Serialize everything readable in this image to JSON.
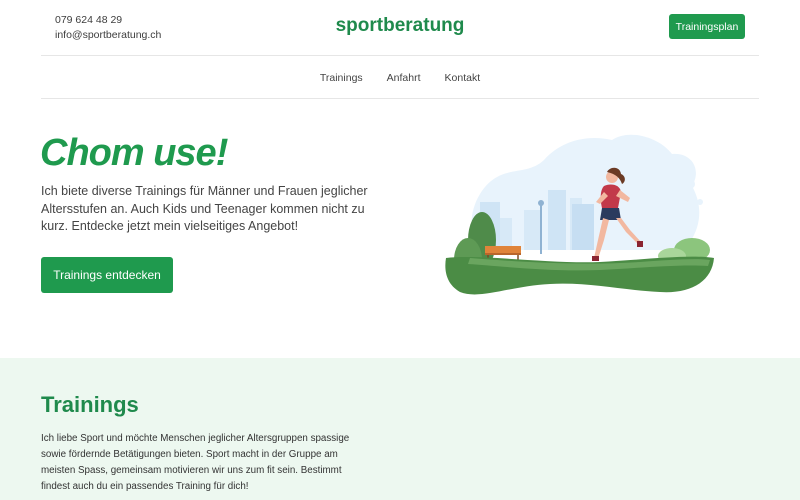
{
  "header": {
    "phone": "079 624 48 29",
    "email": "info@sportberatung.ch",
    "brand": "sportberatung",
    "cta_label": "Trainingsplan"
  },
  "nav": {
    "items": [
      {
        "label": "Trainings"
      },
      {
        "label": "Anfahrt"
      },
      {
        "label": "Kontakt"
      }
    ]
  },
  "hero": {
    "title": "Chom use!",
    "text": "Ich biete diverse Trainings für Männer und Frauen jeglicher Altersstufen an. Auch Kids und Teenager kommen nicht zu kurz. Entdecke jetzt mein vielseitiges Angebot!",
    "button_label": "Trainings entdecken",
    "illustration_icon": "runner-in-park-illustration"
  },
  "trainings": {
    "title": "Trainings",
    "text": "Ich liebe Sport und möchte Menschen jeglicher Altersgruppen spassige sowie fördernde Betätigungen bieten. Sport macht in der Gruppe am meisten Spass, gemeinsam motivieren wir uns zum fit sein. Bestimmt findest auch du ein passendes Training für dich!"
  },
  "colors": {
    "accent": "#1f9a4e",
    "brand_text": "#1f8a4c",
    "section_bg": "#edf8f0"
  }
}
